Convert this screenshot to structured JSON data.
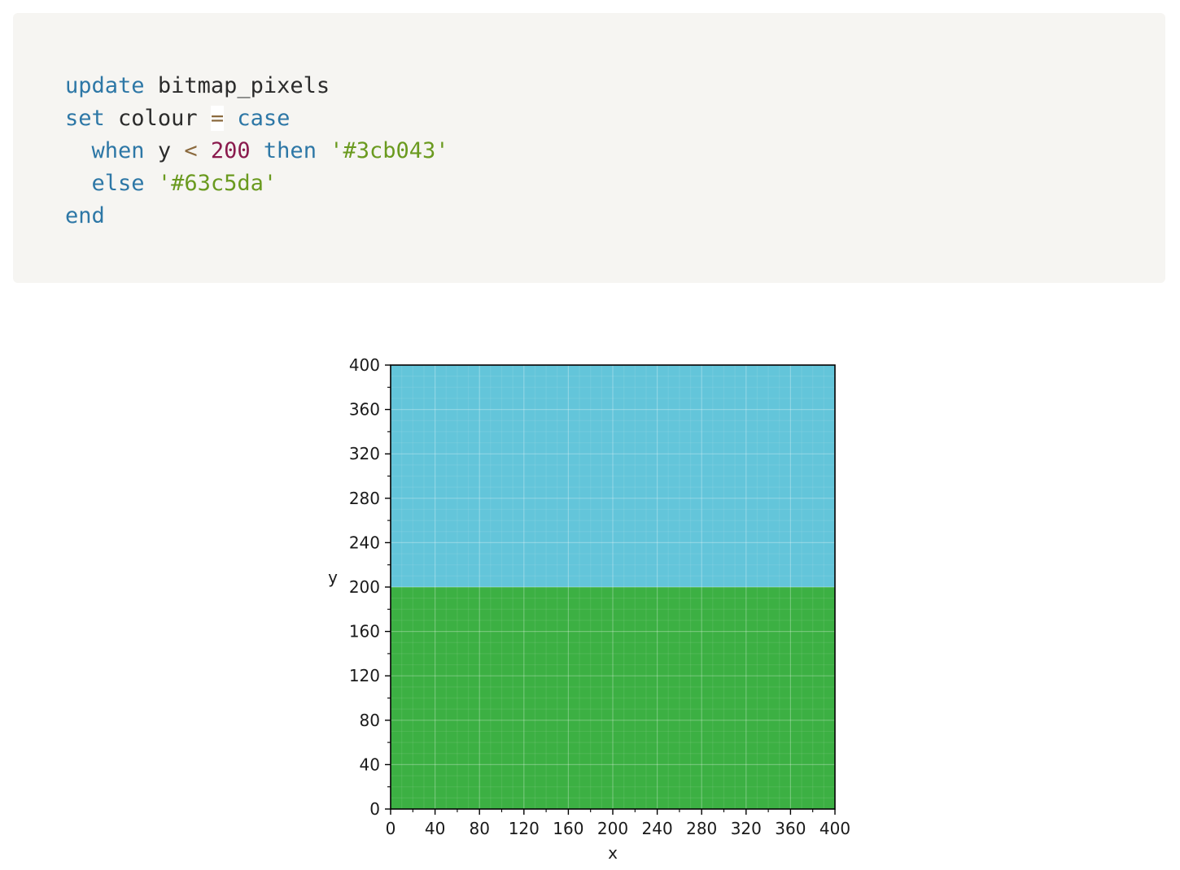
{
  "code": {
    "lines": [
      [
        {
          "t": "kw",
          "v": "update"
        },
        {
          "t": "sp",
          "v": " "
        },
        {
          "t": "id",
          "v": "bitmap_pixels"
        }
      ],
      [
        {
          "t": "kw",
          "v": "set"
        },
        {
          "t": "sp",
          "v": " "
        },
        {
          "t": "id",
          "v": "colour"
        },
        {
          "t": "sp",
          "v": " "
        },
        {
          "t": "op-eq",
          "v": "="
        },
        {
          "t": "sp",
          "v": " "
        },
        {
          "t": "kw",
          "v": "case"
        }
      ],
      [
        {
          "t": "sp",
          "v": "  "
        },
        {
          "t": "kw",
          "v": "when"
        },
        {
          "t": "sp",
          "v": " "
        },
        {
          "t": "id",
          "v": "y"
        },
        {
          "t": "sp",
          "v": " "
        },
        {
          "t": "op",
          "v": "<"
        },
        {
          "t": "sp",
          "v": " "
        },
        {
          "t": "num",
          "v": "200"
        },
        {
          "t": "sp",
          "v": " "
        },
        {
          "t": "kw",
          "v": "then"
        },
        {
          "t": "sp",
          "v": " "
        },
        {
          "t": "str",
          "v": "'#3cb043'"
        }
      ],
      [
        {
          "t": "sp",
          "v": "  "
        },
        {
          "t": "kw",
          "v": "else"
        },
        {
          "t": "sp",
          "v": " "
        },
        {
          "t": "str",
          "v": "'#63c5da'"
        }
      ],
      [
        {
          "t": "kw",
          "v": "end"
        }
      ]
    ]
  },
  "chart_data": {
    "type": "heatmap",
    "title": "",
    "xlabel": "x",
    "ylabel": "y",
    "xlim": [
      0,
      400
    ],
    "ylim": [
      0,
      400
    ],
    "x_ticks": [
      0,
      40,
      80,
      120,
      160,
      200,
      240,
      280,
      320,
      360,
      400
    ],
    "y_ticks": [
      0,
      40,
      80,
      120,
      160,
      200,
      240,
      280,
      320,
      360,
      400
    ],
    "grid": true,
    "regions": [
      {
        "name": "y < 200",
        "y_range": [
          0,
          200
        ],
        "color": "#3cb043"
      },
      {
        "name": "else",
        "y_range": [
          200,
          400
        ],
        "color": "#63c5da"
      }
    ]
  }
}
